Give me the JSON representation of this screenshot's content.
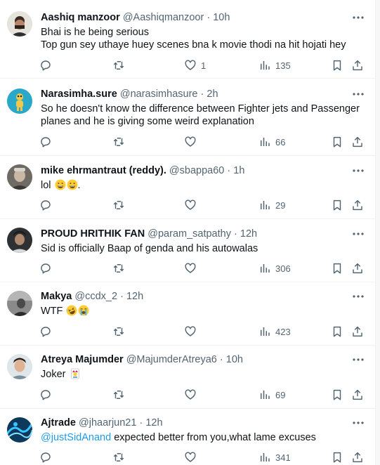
{
  "replies": [
    {
      "name": "Aashiq manzoor",
      "handle": "@Aashiqmanzoor",
      "time": "10h",
      "lines": [
        "Bhai is he being serious",
        "Top gun sey uthaye huey scenes bna k movie thodi na hit hojati hey"
      ],
      "likes": "1",
      "views": "135"
    },
    {
      "name": "Narasimha.sure",
      "handle": "@narasimhasure",
      "time": "2h",
      "lines": [
        "So he doesn't know the difference between Fighter jets and Passenger",
        "planes and he is giving some weird explanation"
      ],
      "likes": "",
      "views": "66"
    },
    {
      "name": "mike ehrmantraut (reddy).",
      "handle": "@sbappa60",
      "time": "1h",
      "text": "lol",
      "suffix": ".",
      "emojis": [
        "grinning-face",
        "grinning-face"
      ],
      "likes": "",
      "views": "29"
    },
    {
      "name": "PROUD HRITHIK FAN",
      "handle": "@param_satpathy",
      "time": "12h",
      "text": "Sid is officially Baap of genda and his autowalas",
      "likes": "",
      "views": "306"
    },
    {
      "name": "Makya",
      "handle": "@ccdx_2",
      "time": "12h",
      "text": "WTF",
      "emojis": [
        "rolling-laughing",
        "loudly-crying"
      ],
      "likes": "",
      "views": "423"
    },
    {
      "name": "Atreya Majumder",
      "handle": "@MajumderAtreya6",
      "time": "10h",
      "text": "Joker",
      "emojis": [
        "joker-card"
      ],
      "likes": "",
      "views": "69"
    },
    {
      "name": "Ajtrade",
      "handle": "@jhaarjun21",
      "time": "12h",
      "mention": "@justSidAnand",
      "text": " expected better from you,what lame excuses",
      "likes": "",
      "views": "341"
    }
  ],
  "separator": "·",
  "colors": {
    "accent": "#1d9bf0",
    "muted": "#536471",
    "text": "#0f1419",
    "border": "#eff3f4"
  }
}
